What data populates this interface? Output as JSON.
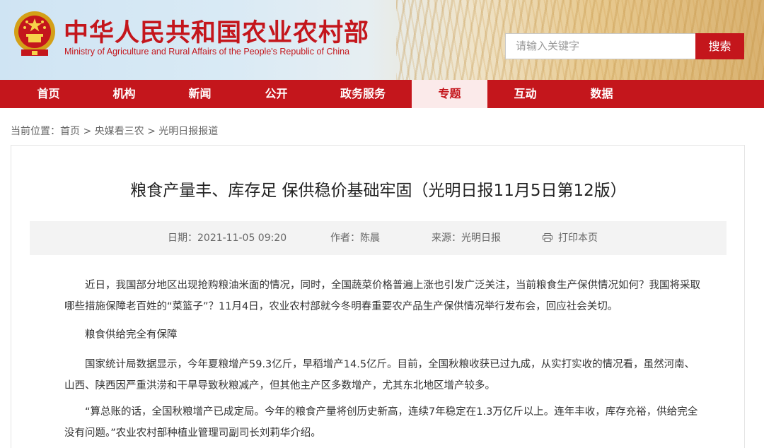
{
  "header": {
    "title_cn": "中华人民共和国农业农村部",
    "title_en": "Ministry of Agriculture and Rural Affairs of the People's Republic of China",
    "search_placeholder": "请输入关键字",
    "search_button": "搜索"
  },
  "nav": {
    "items": [
      {
        "label": "首页"
      },
      {
        "label": "机构"
      },
      {
        "label": "新闻"
      },
      {
        "label": "公开"
      },
      {
        "label": "政务服务"
      },
      {
        "label": "专题"
      },
      {
        "label": "互动"
      },
      {
        "label": "数据"
      }
    ],
    "active_index": 5
  },
  "breadcrumb": {
    "prefix": "当前位置：",
    "items": [
      "首页",
      "央媒看三农",
      "光明日报报道"
    ],
    "separator": ">"
  },
  "article": {
    "title": "粮食产量丰、库存足 保供稳价基础牢固（光明日报11月5日第12版）",
    "meta": {
      "date": "日期：2021-11-05 09:20",
      "author": "作者：陈晨",
      "source": "来源：光明日报",
      "print": "打印本页"
    },
    "paragraphs": [
      "近日，我国部分地区出现抢购粮油米面的情况，同时，全国蔬菜价格普遍上涨也引发广泛关注，当前粮食生产保供情况如何？我国将采取哪些措施保障老百姓的“菜篮子”？11月4日，农业农村部就今冬明春重要农产品生产保供情况举行发布会，回应社会关切。",
      "粮食供给完全有保障",
      "国家统计局数据显示，今年夏粮增产59.3亿斤，早稻增产14.5亿斤。目前，全国秋粮收获已过九成，从实打实收的情况看，虽然河南、山西、陕西因严重洪涝和干旱导致秋粮减产，但其他主产区多数增产，尤其东北地区增产较多。",
      "“算总账的话，全国秋粮增产已成定局。今年的粮食产量将创历史新高，连续7年稳定在1.3万亿斤以上。连年丰收，库存充裕，供给完全没有问题。”农业农村部种植业管理司副司长刘莉华介绍。"
    ]
  },
  "colors": {
    "brand_red": "#c4161c",
    "meta_bg": "#f3f3f3"
  }
}
